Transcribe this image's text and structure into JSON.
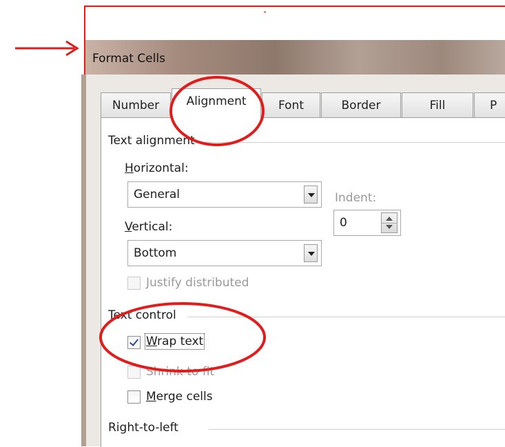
{
  "dialog": {
    "title": "Format Cells"
  },
  "tabs": [
    {
      "label": "Number",
      "active": false
    },
    {
      "label": "Alignment",
      "active": true
    },
    {
      "label": "Font",
      "active": false
    },
    {
      "label": "Border",
      "active": false
    },
    {
      "label": "Fill",
      "active": false
    },
    {
      "label": "P",
      "active": false
    }
  ],
  "text_alignment": {
    "group_label": "Text alignment",
    "horizontal_label_accel": "H",
    "horizontal_label_rest": "orizontal:",
    "horizontal_value": "General",
    "indent_label": "Indent:",
    "indent_value": "0",
    "vertical_label_accel": "V",
    "vertical_label_rest": "ertical:",
    "vertical_value": "Bottom",
    "justify_distributed_label": "Justify distributed"
  },
  "text_control": {
    "group_label": "Text control",
    "wrap_text_accel": "W",
    "wrap_text_rest": "rap text",
    "wrap_text_checked": true,
    "shrink_to_fit_label": "Shrink to fit",
    "shrink_to_fit_checked": false,
    "merge_cells_accel": "M",
    "merge_cells_rest": "erge cells",
    "merge_cells_checked": false
  },
  "right_to_left": {
    "group_label": "Right-to-left"
  },
  "annotations": {
    "color": "#e21b1b",
    "items": [
      "arrow pointing to title",
      "circle around Alignment tab",
      "circle around Text control / Wrap text"
    ]
  }
}
